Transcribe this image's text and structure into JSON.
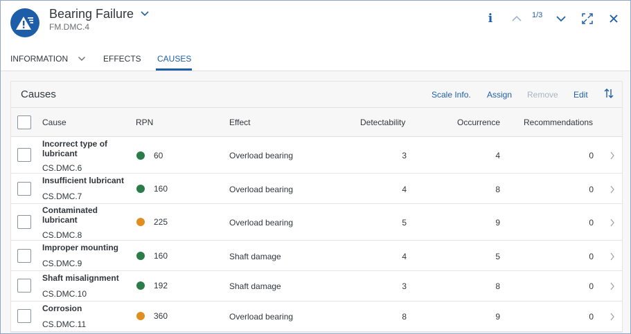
{
  "header": {
    "title": "Bearing Failure",
    "subtitle": "FM.DMC.4",
    "counter": "1/3",
    "info_glyph": "i",
    "avatar_icon": "warning-list-icon",
    "accent_color": "#1e5ea8"
  },
  "tabs": [
    {
      "label": "INFORMATION",
      "has_dropdown": true
    },
    {
      "label": "EFFECTS"
    },
    {
      "label": "CAUSES",
      "selected": true
    }
  ],
  "panel": {
    "title": "Causes",
    "toolbar": {
      "scale_info": "Scale Info.",
      "assign": "Assign",
      "remove": "Remove",
      "edit": "Edit",
      "sort_icon": "sort-icon"
    },
    "columns": [
      "Cause",
      "RPN",
      "Effect",
      "Detectability",
      "Occurrence",
      "Recommendations"
    ]
  },
  "status_colors": {
    "green": "#2b7c49",
    "orange": "#e08e1e"
  },
  "rows": [
    {
      "name": "Incorrect type of lubricant",
      "name_line1": "Incorrect type of",
      "name_line2": "lubricant",
      "id": "CS.DMC.6",
      "rpn": "60",
      "status": "green",
      "effect": "Overload bearing",
      "detectability": "3",
      "occurrence": "4",
      "recommendations": "0"
    },
    {
      "name": "Insufficient lubricant",
      "name_line1": "Insufficient lubricant",
      "name_line2": "",
      "id": "CS.DMC.7",
      "rpn": "160",
      "status": "green",
      "effect": "Overload bearing",
      "detectability": "4",
      "occurrence": "8",
      "recommendations": "0"
    },
    {
      "name": "Contaminated lubricant",
      "name_line1": "Contaminated",
      "name_line2": "lubricant",
      "id": "CS.DMC.8",
      "rpn": "225",
      "status": "orange",
      "effect": "Overload bearing",
      "detectability": "5",
      "occurrence": "9",
      "recommendations": "0"
    },
    {
      "name": "Improper mounting",
      "name_line1": "Improper mounting",
      "name_line2": "",
      "id": "CS.DMC.9",
      "rpn": "160",
      "status": "green",
      "effect": "Shaft damage",
      "detectability": "4",
      "occurrence": "5",
      "recommendations": "0"
    },
    {
      "name": "Shaft misalignment",
      "name_line1": "Shaft misalignment",
      "name_line2": "",
      "id": "CS.DMC.10",
      "rpn": "192",
      "status": "green",
      "effect": "Shaft damage",
      "detectability": "3",
      "occurrence": "8",
      "recommendations": "0"
    },
    {
      "name": "Corrosion",
      "name_line1": "Corrosion",
      "name_line2": "",
      "id": "CS.DMC.11",
      "rpn": "360",
      "status": "orange",
      "effect": "Overload bearing",
      "detectability": "8",
      "occurrence": "9",
      "recommendations": "0"
    }
  ]
}
